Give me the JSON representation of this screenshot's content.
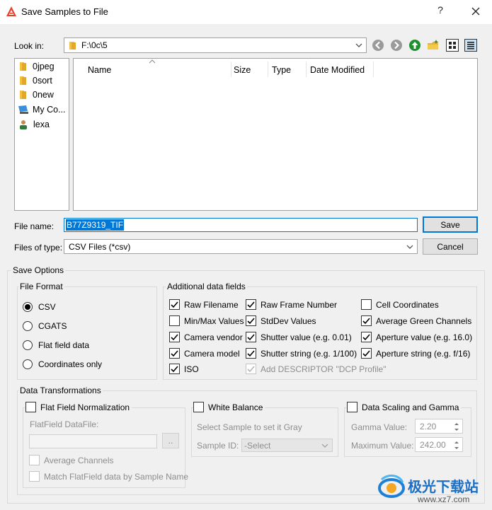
{
  "window": {
    "title": "Save Samples to File",
    "help": "?"
  },
  "look_in": {
    "label": "Look in:",
    "path": "F:\\0c\\5"
  },
  "sidebar": {
    "items": [
      {
        "label": "0jpeg",
        "icon": "folder-icon"
      },
      {
        "label": "0sort",
        "icon": "folder-icon"
      },
      {
        "label": "0new",
        "icon": "folder-icon"
      },
      {
        "label": "My Co...",
        "icon": "computer-icon"
      },
      {
        "label": "lexa",
        "icon": "user-icon"
      }
    ]
  },
  "file_list": {
    "columns": [
      "Name",
      "Size",
      "Type",
      "Date Modified"
    ]
  },
  "file_name": {
    "label": "File name:",
    "value": "B77Z9319_TIF"
  },
  "file_type": {
    "label": "Files of type:",
    "value": "CSV Files (*csv)"
  },
  "buttons": {
    "save": "Save",
    "cancel": "Cancel",
    "browse": ".."
  },
  "save_options": {
    "title": "Save Options",
    "file_format": {
      "title": "File Format",
      "options": [
        "CSV",
        "CGATS",
        "Flat field data",
        "Coordinates only"
      ],
      "selected": "CSV"
    },
    "additional": {
      "title": "Additional data fields",
      "fields": [
        {
          "label": "Raw Filename",
          "checked": true
        },
        {
          "label": "Raw Frame Number",
          "checked": true
        },
        {
          "label": "Cell Coordinates",
          "checked": false
        },
        {
          "label": "Min/Max Values",
          "checked": false
        },
        {
          "label": "StdDev Values",
          "checked": true
        },
        {
          "label": "Average Green Channels",
          "checked": true
        },
        {
          "label": "Camera vendor",
          "checked": true
        },
        {
          "label": "Shutter value (e.g. 0.01)",
          "checked": true
        },
        {
          "label": "Aperture value (e.g. 16.0)",
          "checked": true
        },
        {
          "label": "Camera model",
          "checked": true
        },
        {
          "label": "Shutter string (e.g. 1/100)",
          "checked": true
        },
        {
          "label": "Aperture string (e.g. f/16)",
          "checked": true
        },
        {
          "label": "ISO",
          "checked": true
        },
        {
          "label": "Add DESCRIPTOR \"DCP Profile\"",
          "checked": true,
          "disabled": true
        }
      ]
    }
  },
  "transformations": {
    "title": "Data Transformations",
    "flat_field": {
      "title": "Flat Field Normalization",
      "datafile_label": "FlatField DataFile:",
      "average_channels": "Average Channels",
      "match_by_name": "Match FlatField data by Sample Name"
    },
    "white_balance": {
      "title": "White Balance",
      "hint": "Select Sample to set it Gray",
      "sample_id_label": "Sample ID:",
      "sample_id_value": "-Select"
    },
    "scaling": {
      "title": "Data Scaling and Gamma",
      "gamma_label": "Gamma Value:",
      "gamma_value": "2.20",
      "max_label": "Maximum Value:",
      "max_value": "242.00"
    }
  },
  "watermark": {
    "text": "极光下载站",
    "url": "www.xz7.com"
  },
  "colors": {
    "accent": "#0078d7",
    "selection": "#0078d7",
    "folder": "#f3c040"
  }
}
